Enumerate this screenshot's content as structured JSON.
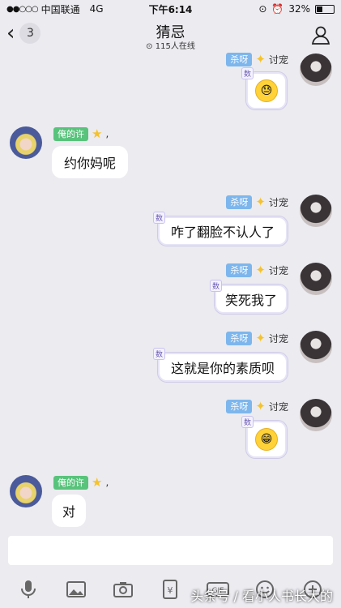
{
  "status_bar": {
    "carrier": "中国联通",
    "network": "4G",
    "time": "下午6:14",
    "battery": "32%"
  },
  "header": {
    "back_count": "3",
    "title": "猜忌",
    "online": "115人在线"
  },
  "messages": [
    {
      "side": "right",
      "title_tag": "杀呀",
      "nickname": "讨宠",
      "badge": "数",
      "content": "emoji-sweat"
    },
    {
      "side": "left",
      "title_tag": "俺的许",
      "content": "约你妈呢"
    },
    {
      "side": "right",
      "title_tag": "杀呀",
      "nickname": "讨宠",
      "badge": "数",
      "content": "咋了翻脸不认人了"
    },
    {
      "side": "right",
      "title_tag": "杀呀",
      "nickname": "讨宠",
      "badge": "数",
      "content": "笑死我了"
    },
    {
      "side": "right",
      "title_tag": "杀呀",
      "nickname": "讨宠",
      "badge": "数",
      "content": "这就是你的素质呗"
    },
    {
      "side": "right",
      "title_tag": "杀呀",
      "nickname": "讨宠",
      "badge": "数",
      "content": "emoji-grin"
    },
    {
      "side": "left",
      "title_tag": "俺的许",
      "content": "对"
    }
  ],
  "toolbar": [
    "mic-icon",
    "image-icon",
    "camera-icon",
    "red-packet-icon",
    "gif-icon",
    "emoji-icon",
    "plus-icon"
  ],
  "toolbar_labels": {
    "gif": "GIF"
  },
  "watermark": "头条号 / 看小人书长大的"
}
